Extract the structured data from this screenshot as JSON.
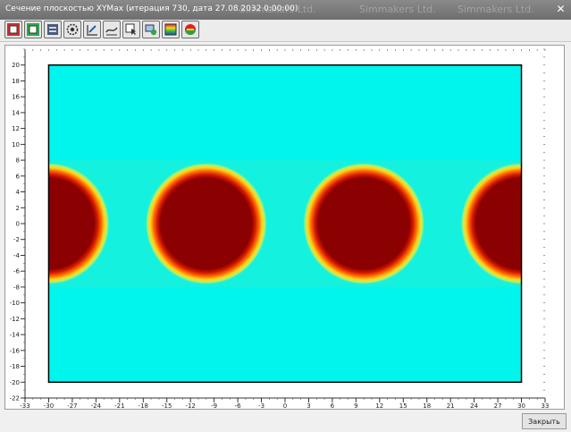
{
  "window": {
    "title": "Сечение плоскостью XYMax (итерация 730, дата 27.08.2032 0:00:00)",
    "watermark_text": "Simmakers Ltd.",
    "close_label": "✕"
  },
  "toolbar": {
    "icons": [
      "copy-image-icon",
      "save-image-icon",
      "export-icon",
      "settings-icon",
      "edit-plot-icon",
      "contour-icon",
      "pointer-info-icon",
      "layers-icon",
      "palette-gradient-icon",
      "color-wheel-icon"
    ]
  },
  "footer": {
    "close_button_label": "Закрыть"
  },
  "colors": {
    "background_field": "#00f5ec",
    "hot_core": "#8b0000",
    "hot_ring": "#ffd21a",
    "frame": "#000000"
  },
  "chart_data": {
    "type": "heatmap",
    "title": "",
    "xlabel": "",
    "ylabel": "",
    "xlim": [
      -33,
      33
    ],
    "ylim": [
      -22,
      22
    ],
    "domain_x": [
      -30,
      30
    ],
    "domain_y": [
      -20,
      20
    ],
    "x_ticks": [
      -33,
      -30,
      -27,
      -24,
      -21,
      -18,
      -15,
      -12,
      -9,
      -6,
      -3,
      0,
      3,
      6,
      9,
      12,
      15,
      18,
      21,
      24,
      27,
      30,
      33
    ],
    "y_ticks": [
      20,
      18,
      16,
      14,
      12,
      10,
      8,
      6,
      4,
      2,
      0,
      -2,
      -4,
      -6,
      -8,
      -10,
      -12,
      -14,
      -16,
      -18,
      -20,
      -22
    ],
    "x_minor_step": 1,
    "y_minor_step": 1,
    "grid": false,
    "hot_spots": [
      {
        "cx": -30,
        "cy": 0,
        "r": 6.6
      },
      {
        "cx": -10,
        "cy": 0,
        "r": 6.6
      },
      {
        "cx": 10,
        "cy": 0,
        "r": 6.6
      },
      {
        "cx": 30,
        "cy": 0,
        "r": 6.6
      }
    ]
  }
}
